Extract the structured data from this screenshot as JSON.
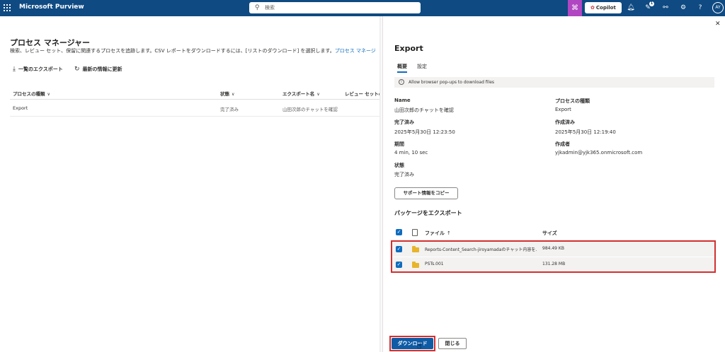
{
  "topbar": {
    "app_name": "Microsoft Purview",
    "search_placeholder": "検索",
    "copilot_label": "Copilot",
    "notification_count": "1",
    "avatar_initials": "AY"
  },
  "page": {
    "title": "プロセス マネージャー",
    "description": "検索、レビュー セット、保留に関連するプロセスを追跡します。CSV レポートをダウンロードするには、[リストのダウンロード] を選択します。",
    "description_link": "プロセス マネージ",
    "commands": {
      "export_list": "一覧のエクスポート",
      "refresh": "最新の情報に更新"
    },
    "table": {
      "headers": [
        "プロセスの種類",
        "状態",
        "エクスポート名",
        "レビュー セットの"
      ],
      "rows": [
        [
          "Export",
          "完了済み",
          "山田次郎のチャットを確認"
        ]
      ]
    }
  },
  "panel": {
    "title": "Export",
    "tabs": [
      "概要",
      "設定"
    ],
    "active_tab": 0,
    "message": "Allow browser pop-ups to download files",
    "fields": {
      "name_label": "Name",
      "name_value": "山田次郎のチャットを確認",
      "process_type_label": "プロセスの種類",
      "process_type_value": "Export",
      "completed_label": "完了済み",
      "completed_value": "2025年5月30日 12:23:50",
      "created_label": "作成済み",
      "created_value": "2025年5月30日 12:19:40",
      "duration_label": "期間",
      "duration_value": "4 min, 10 sec",
      "creator_label": "作成者",
      "creator_value": "yjkadmin@yjk365.onmicrosoft.com",
      "status_label": "状態",
      "status_value": "完了済み"
    },
    "copy_support_button": "サポート情報をコピー",
    "package_section_title": "パッケージをエクスポート",
    "files_table": {
      "header_file": "ファイル",
      "header_size": "サイズ",
      "sort_indicator": "↑",
      "rows": [
        {
          "name": "Reports-Content_Search-jiroyamadaのチャット内容を...",
          "size": "984.49 KB",
          "checked": true
        },
        {
          "name": "PSTs.001",
          "size": "131.28 MB",
          "checked": true
        }
      ]
    },
    "download_button": "ダウンロード",
    "close_button": "閉じる"
  },
  "colors": {
    "topbar": "#0f4a82",
    "accent": "#0f6cbd",
    "copilot_highlight": "#b146c2",
    "annotation_red": "#d32f2f",
    "folder": "#e8b42b"
  }
}
